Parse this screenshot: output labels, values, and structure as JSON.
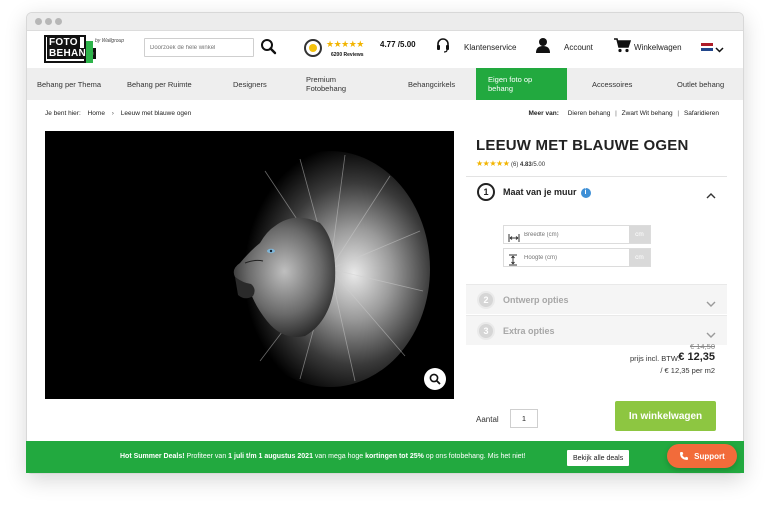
{
  "header": {
    "logo_line1": "FOTO",
    "logo_line2": "BEHANG",
    "logo_tagline": "by Wallgroup",
    "search_placeholder": "Doorzoek de hele winkel",
    "trust_score": "4.77 /5.00",
    "trust_reviews": "6200 Reviews",
    "customer_service": "Klantenservice",
    "account": "Account",
    "cart": "Winkelwagen"
  },
  "nav": {
    "items": [
      {
        "label": "Behang per Thema"
      },
      {
        "label": "Behang per Ruimte"
      },
      {
        "label": "Designers"
      },
      {
        "label": "Premium Fotobehang"
      },
      {
        "label": "Behangcirkels"
      },
      {
        "label": "Eigen foto op behang"
      },
      {
        "label": "Accessoires"
      },
      {
        "label": "Outlet behang"
      }
    ],
    "active_index": 5
  },
  "breadcrumb": {
    "prefix": "Je bent hier:",
    "home": "Home",
    "current": "Leeuw met blauwe ogen"
  },
  "meer_van": {
    "label": "Meer van:",
    "links": [
      "Dieren behang",
      "Zwart Wit behang",
      "Safaridieren"
    ]
  },
  "product": {
    "title": "LEEUW MET BLAUWE OGEN",
    "rating_stars": "★★★★★",
    "rating_count": "(6)",
    "rating_score": "4.83",
    "rating_max": "/5.00"
  },
  "config": {
    "sections": [
      {
        "number": "1",
        "label": "Maat van je muur"
      },
      {
        "number": "2",
        "label": "Ontwerp opties"
      },
      {
        "number": "3",
        "label": "Extra opties"
      }
    ],
    "width_placeholder": "Breedte (cm)",
    "height_placeholder": "Hoogte (cm)",
    "unit": "cm"
  },
  "pricing": {
    "old_price": "€ 14,50",
    "label": "prijs incl. BTW:",
    "price": "€ 12,35",
    "per_m2": "/ € 12,35 per m2"
  },
  "purchase": {
    "qty_label": "Aantal",
    "qty_value": "1",
    "cart_button": "In winkelwagen"
  },
  "promo": {
    "lead": "Hot Summer Deals!",
    "text1": " Profiteer van ",
    "dates": "1 juli t/m 1 augustus 2021",
    "text2": " van mega hoge ",
    "kortingen": "kortingen tot 25%",
    "text3": " op ons fotobehang. Mis het niet!",
    "button": "Bekijk alle deals"
  },
  "support": {
    "label": "Support"
  },
  "colors": {
    "brand_green": "#22a93f",
    "cart_green": "#8dc641",
    "support_orange": "#f26b3a",
    "star_gold": "#f2b400"
  }
}
